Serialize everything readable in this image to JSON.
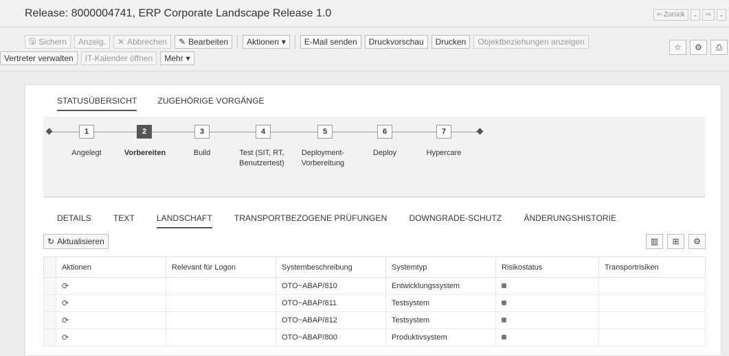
{
  "window": {
    "title": "Release: 8000004741, ERP Corporate Landscape Release 1.0",
    "back_label": "Zurück"
  },
  "toolbar": {
    "row1": [
      {
        "label": "Sichern",
        "disabled": true,
        "icon": "save-icon"
      },
      {
        "label": "Anzeig.",
        "disabled": true
      },
      {
        "label": "Abbrechen",
        "disabled": true,
        "icon": "cancel-icon"
      },
      {
        "label": "Bearbeiten",
        "disabled": false,
        "icon": "edit-icon"
      },
      {
        "label": "Aktionen",
        "disabled": false,
        "dropdown": true
      },
      {
        "label": "E-Mail senden",
        "disabled": false
      },
      {
        "label": "Druckvorschau",
        "disabled": false
      },
      {
        "label": "Drucken",
        "disabled": false
      },
      {
        "label": "Objektbeziehungen anzeigen",
        "disabled": true
      }
    ],
    "row2": [
      {
        "label": "Vertreter verwalten",
        "disabled": false
      },
      {
        "label": "IT-Kalender öffnen",
        "disabled": true
      },
      {
        "label": "Mehr",
        "disabled": false,
        "dropdown": true
      }
    ],
    "icons": [
      "favorite-icon",
      "personalize-icon",
      "print-icon"
    ]
  },
  "status_tabs": [
    {
      "label": "STATUSÜBERSICHT",
      "active": true
    },
    {
      "label": "ZUGEHÖRIGE VORGÄNGE",
      "active": false
    }
  ],
  "phases": [
    {
      "num": "1",
      "label": "Angelegt",
      "active": false
    },
    {
      "num": "2",
      "label": "Vorbereiten",
      "active": true
    },
    {
      "num": "3",
      "label": "Build",
      "active": false
    },
    {
      "num": "4",
      "label": "Test (SIT, RT, Benutzertest)",
      "active": false
    },
    {
      "num": "5",
      "label": "Deployment-Vorbereitung",
      "active": false
    },
    {
      "num": "6",
      "label": "Deploy",
      "active": false
    },
    {
      "num": "7",
      "label": "Hypercare",
      "active": false
    }
  ],
  "detail_tabs": [
    {
      "label": "DETAILS",
      "active": false
    },
    {
      "label": "TEXT",
      "active": false
    },
    {
      "label": "LANDSCHAFT",
      "active": true
    },
    {
      "label": "TRANSPORTBEZOGENE PRÜFUNGEN",
      "active": false
    },
    {
      "label": "DOWNGRADE-SCHUTZ",
      "active": false
    },
    {
      "label": "ÄNDERUNGSHISTORIE",
      "active": false
    }
  ],
  "refresh_label": "Aktualisieren",
  "table": {
    "columns": [
      "Aktionen",
      "Relevant für Logon",
      "Systembeschreibung",
      "Systemtyp",
      "Risikostatus",
      "Transportrisiken"
    ],
    "rows": [
      {
        "system": "OTO~ABAP/810",
        "type": "Entwicklungssystem"
      },
      {
        "system": "OTO~ABAP/811",
        "type": "Testsystem"
      },
      {
        "system": "OTO~ABAP/812",
        "type": "Testsystem"
      },
      {
        "system": "OTO~ABAP/800",
        "type": "Produktivsystem"
      }
    ]
  }
}
